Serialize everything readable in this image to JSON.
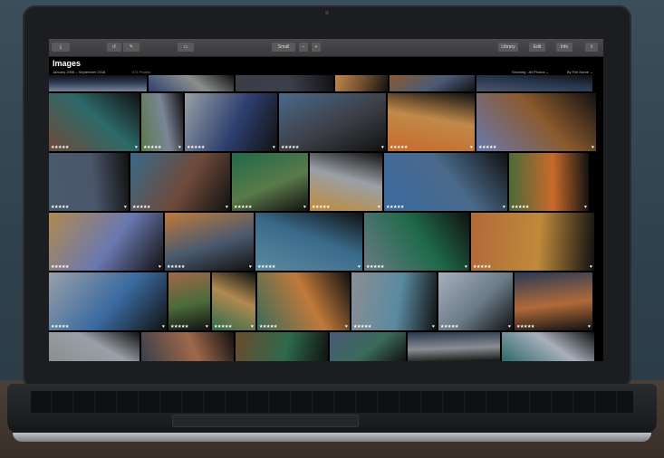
{
  "toolbar": {
    "left_buttons": [
      "",
      "",
      ""
    ],
    "view_label": "Small",
    "right_tabs": [
      "Library",
      "Edit",
      "Info"
    ]
  },
  "header": {
    "title": "Images",
    "date_range": "January 2006 – September 2018",
    "count": "471 Photos",
    "showing": "Showing : All Photos ⌄",
    "sort_by": "By File Name ⌄"
  },
  "rating_stars": "★★★★★",
  "heart_icon": "♥",
  "tile_colors": [
    "#2a3a55",
    "#8a8f8e",
    "#3a3f4a",
    "#6a4a2e",
    "#4a5a78",
    "#27364e",
    "#2d6a6a",
    "#7a8596",
    "#2c3f6e",
    "#3c3e46",
    "#c08a4a",
    "#8b5a2e",
    "#4a566a",
    "#6e4a3a",
    "#5a7a4a",
    "#9aa0a6",
    "#4a6a8a",
    "#c86a2a",
    "#6a78b0",
    "#4a5a6e",
    "#3a6a8a",
    "#1f6a4a",
    "#c08a3a",
    "#3a6aa0",
    "#4a6a3a",
    "#b08a50",
    "#c07a3a",
    "#5a8aa0",
    "#6a7a86",
    "#b06a3a",
    "#9aa0a8",
    "#a0684a",
    "#2e6a4a",
    "#3a6a5a",
    "#8a8e94",
    "#a8b0bc"
  ]
}
